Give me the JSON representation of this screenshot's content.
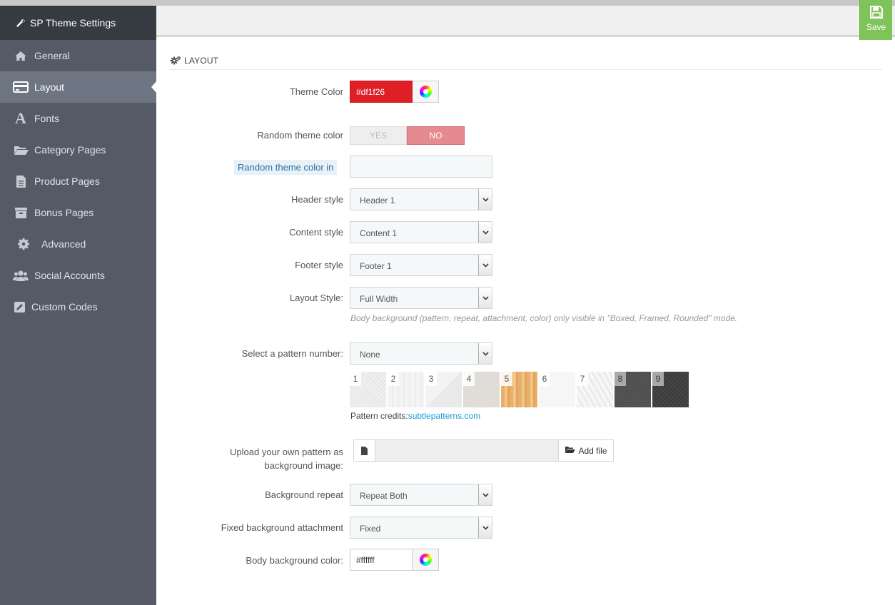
{
  "sidebar": {
    "title": "SP Theme Settings",
    "items": [
      {
        "label": "General",
        "icon": "home-icon"
      },
      {
        "label": "Layout",
        "icon": "credit-card-icon"
      },
      {
        "label": "Fonts",
        "icon": "font-icon"
      },
      {
        "label": "Category Pages",
        "icon": "folder-open-icon"
      },
      {
        "label": "Product Pages",
        "icon": "file-icon"
      },
      {
        "label": "Bonus Pages",
        "icon": "archive-icon"
      },
      {
        "label": "Advanced",
        "icon": "gear-icon"
      },
      {
        "label": "Social Accounts",
        "icon": "users-icon"
      },
      {
        "label": "Custom Codes",
        "icon": "pencil-square-icon"
      }
    ]
  },
  "toolbar": {
    "save_label": "Save"
  },
  "panel": {
    "heading": "LAYOUT"
  },
  "form": {
    "theme_color": {
      "label": "Theme Color",
      "value": "#df1f26",
      "swatch": "#df1f26"
    },
    "random_color": {
      "label": "Random theme color",
      "yes": "YES",
      "no": "NO",
      "selected": "NO"
    },
    "random_color_in": {
      "label": "Random theme color in",
      "value": ""
    },
    "header_style": {
      "label": "Header style",
      "value": "Header 1"
    },
    "content_style": {
      "label": "Content style",
      "value": "Content 1"
    },
    "footer_style": {
      "label": "Footer style",
      "value": "Footer 1"
    },
    "layout_style": {
      "label": "Layout Style:",
      "value": "Full Width",
      "help": "Body background (pattern, repeat, attachment, color) only visible in \"Boxed, Framed, Rounded\" mode."
    },
    "pattern": {
      "label": "Select a pattern number:",
      "value": "None",
      "items": [
        "1",
        "2",
        "3",
        "4",
        "5",
        "6",
        "7",
        "8",
        "9"
      ],
      "credits_prefix": "Pattern credits:",
      "credits_link": "subtlepatterns.com"
    },
    "upload": {
      "label_line1": "Upload your own pattern as",
      "label_line2": "background image:",
      "button": "Add file"
    },
    "bg_repeat": {
      "label": "Background repeat",
      "value": "Repeat Both"
    },
    "bg_attachment": {
      "label": "Fixed background attachment",
      "value": "Fixed"
    },
    "body_bg_color": {
      "label": "Body background color:",
      "value": "#ffffff"
    }
  },
  "colors": {
    "accent": "#df1f26",
    "save": "#7fc458",
    "sidebar": "#555a66",
    "sidebar_header": "#363a41"
  }
}
